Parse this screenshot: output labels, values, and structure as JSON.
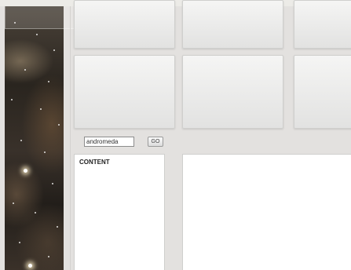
{
  "search": {
    "value": "andromeda",
    "button_label": "GO"
  },
  "content_panel": {
    "heading": "CONTENT"
  },
  "colors": {
    "background": "#e3e1df",
    "tile_top": "#f5f5f4",
    "tile_bottom": "#e2e2e1",
    "panel": "#ffffff"
  }
}
